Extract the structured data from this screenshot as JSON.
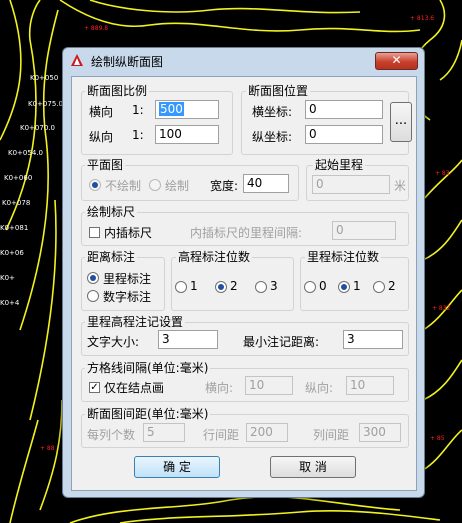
{
  "dialog": {
    "title": "绘制纵断面图",
    "close_glyph": "✕"
  },
  "section_scale": {
    "title": "断面图比例",
    "horizontal_label": "横向",
    "horizontal_prefix": "1:",
    "horizontal_value": "500",
    "vertical_label": "纵向",
    "vertical_prefix": "1:",
    "vertical_value": "100"
  },
  "section_position": {
    "title": "断面图位置",
    "x_label": "横坐标:",
    "x_value": "0",
    "y_label": "纵坐标:",
    "y_value": "0",
    "pick_button": "..."
  },
  "plan": {
    "title": "平面图",
    "no_draw_label": "不绘制",
    "draw_label": "绘制",
    "width_label": "宽度:",
    "width_value": "40"
  },
  "start_mileage": {
    "title": "起始里程",
    "value": "0",
    "unit": "米"
  },
  "ruler": {
    "title": "绘制标尺",
    "interpolate_label": "内插标尺",
    "interval_label": "内插标尺的里程间隔:",
    "interval_value": "0"
  },
  "distance_annotation": {
    "title": "距离标注",
    "mileage_label": "里程标注",
    "number_label": "数字标注"
  },
  "elevation_digits": {
    "title": "高程标注位数",
    "options": [
      "1",
      "2",
      "3"
    ]
  },
  "mileage_digits": {
    "title": "里程标注位数",
    "options": [
      "0",
      "1",
      "2"
    ]
  },
  "annotation_settings": {
    "title": "里程高程注记设置",
    "font_size_label": "文字大小:",
    "font_size_value": "3",
    "min_distance_label": "最小注记距离:",
    "min_distance_value": "3"
  },
  "grid_spacing": {
    "title": "方格线间隔(单位:毫米)",
    "only_nodes_label": "仅在结点画",
    "horizontal_label": "横向:",
    "horizontal_value": "10",
    "vertical_label": "纵向:",
    "vertical_value": "10"
  },
  "section_spacing": {
    "title": "断面图间距(单位:毫米)",
    "per_column_label": "每列个数",
    "per_column_value": "5",
    "row_spacing_label": "行间距",
    "row_spacing_value": "200",
    "column_spacing_label": "列间距",
    "column_spacing_value": "300"
  },
  "buttons": {
    "ok": "确    定",
    "cancel": "取    消"
  },
  "colors": {
    "contour": "#f2f21e",
    "point_label": "#ffffff",
    "marker": "#ff2020",
    "dialog_frame": "#c9d9ec",
    "close_button": "#c8402c",
    "selection": "#3399ff"
  }
}
